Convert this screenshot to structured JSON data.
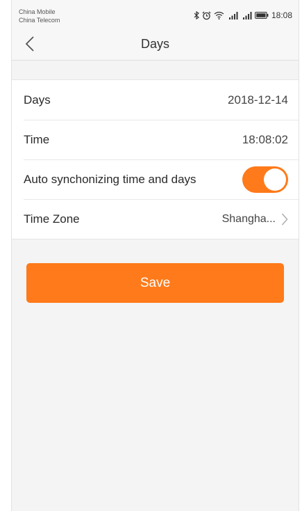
{
  "status_bar": {
    "carrier_1": "China Mobile",
    "carrier_2": "China Telecom",
    "time": "18:08",
    "icons": [
      "bluetooth-icon",
      "alarm-icon",
      "wifi-icon",
      "signal-icon",
      "signal-icon",
      "battery-icon"
    ]
  },
  "nav": {
    "back_icon": "chevron-left-icon",
    "title": "Days"
  },
  "settings": {
    "days_label": "Days",
    "days_value": "2018-12-14",
    "time_label": "Time",
    "time_value": "18:08:02",
    "auto_sync_label": "Auto synchonizing time and days",
    "auto_sync_on": true,
    "timezone_label": "Time Zone",
    "timezone_value": "Shangha...",
    "timezone_icon": "chevron-right-icon"
  },
  "save_label": "Save",
  "colors": {
    "accent": "#ff7a1a",
    "background": "#f4f4f4",
    "list_background": "#ffffff"
  }
}
